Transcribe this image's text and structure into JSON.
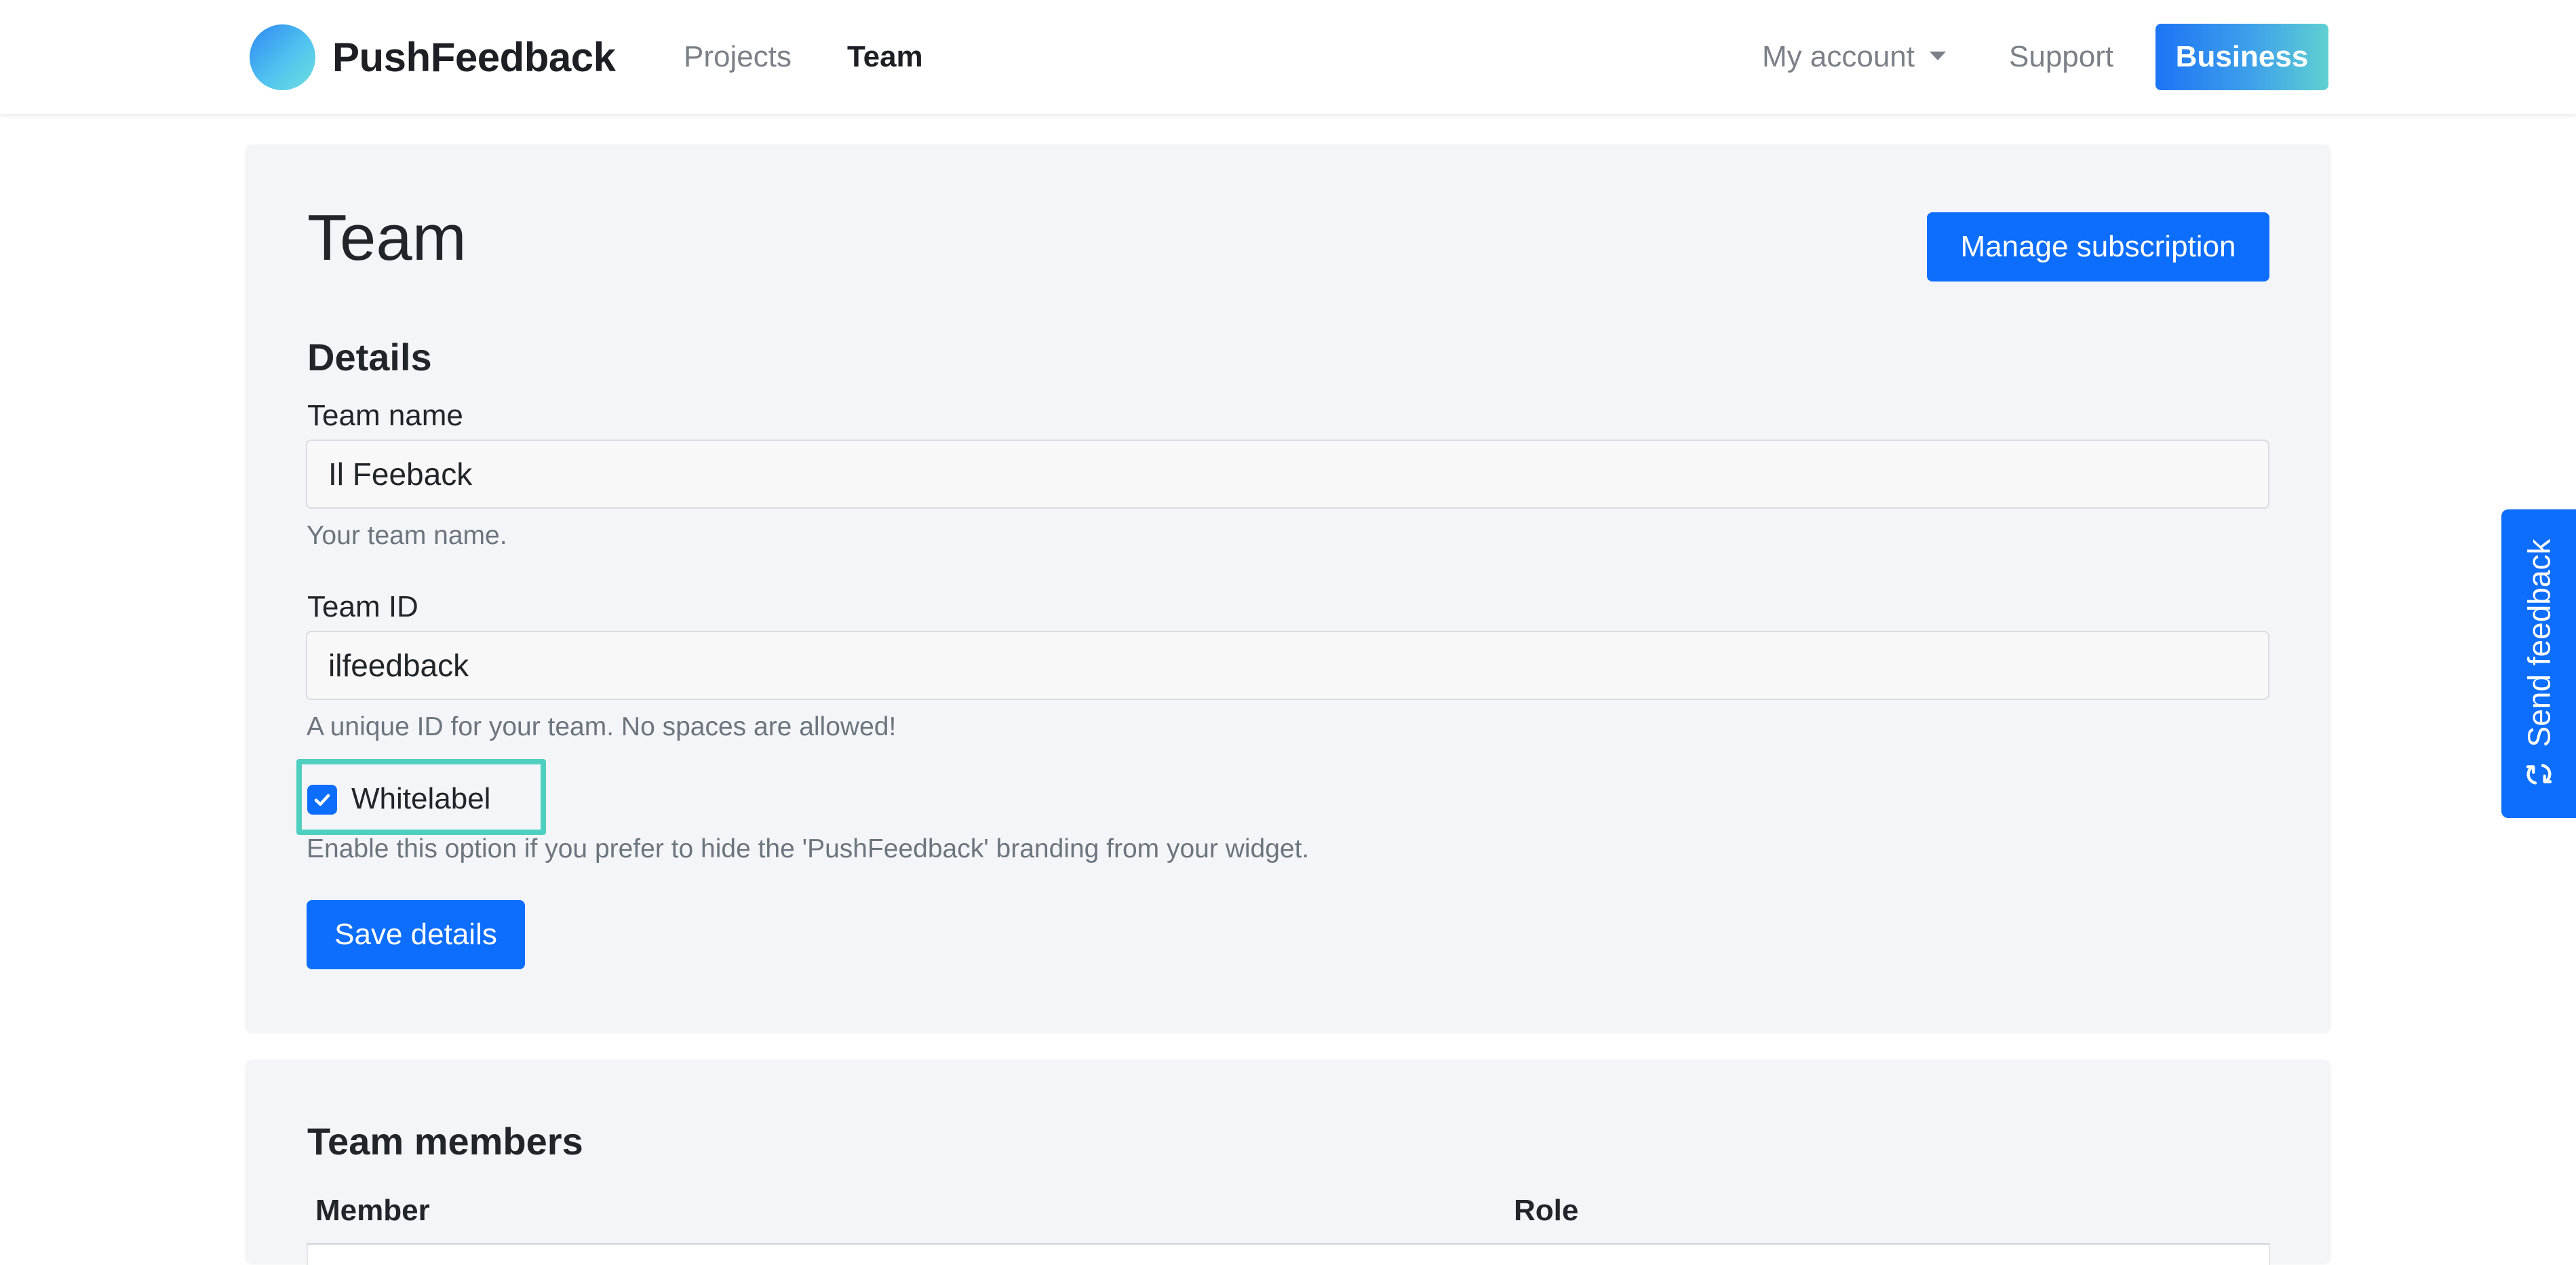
{
  "navbar": {
    "brand_name": "PushFeedback",
    "links": {
      "projects": "Projects",
      "team": "Team",
      "my_account": "My account",
      "support": "Support"
    },
    "business_label": "Business"
  },
  "team_card": {
    "title": "Team",
    "manage_subscription_label": "Manage subscription",
    "details_heading": "Details",
    "team_name": {
      "label": "Team name",
      "value": "Il Feeback",
      "help": "Your team name."
    },
    "team_id": {
      "label": "Team ID",
      "value": "ilfeedback",
      "help": "A unique ID for your team. No spaces are allowed!"
    },
    "whitelabel": {
      "label": "Whitelabel",
      "checked": true,
      "help": "Enable this option if you prefer to hide the 'PushFeedback' branding from your widget."
    },
    "save_label": "Save details"
  },
  "members_card": {
    "heading": "Team members",
    "columns": [
      "Member",
      "Role"
    ]
  },
  "side_tab": {
    "label": "Send feedback",
    "icon": "refresh-arrows-icon"
  },
  "colors": {
    "primary": "#0d6efd",
    "highlight": "#4fcfbf",
    "card_bg": "#f4f5f8"
  }
}
